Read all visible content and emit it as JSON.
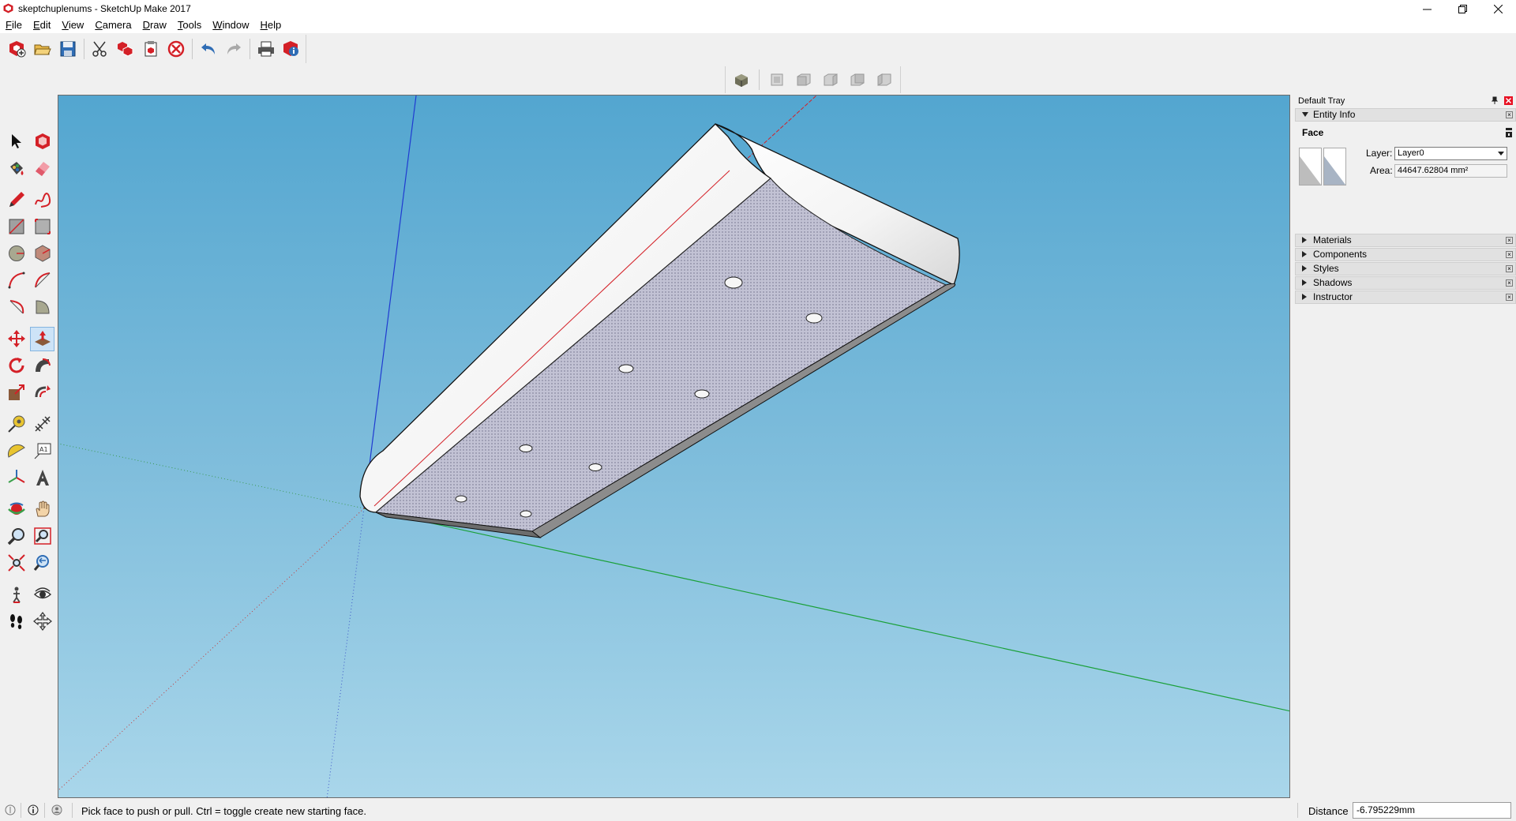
{
  "window": {
    "title": "skeptchuplenums - SketchUp Make 2017",
    "minimize_icon": "minimize-icon",
    "restore_icon": "restore-icon",
    "close_icon": "close-icon"
  },
  "menu": {
    "items": [
      "File",
      "Edit",
      "View",
      "Camera",
      "Draw",
      "Tools",
      "Window",
      "Help"
    ]
  },
  "toolbar": {
    "buttons": [
      "new-model-icon",
      "open-icon",
      "save-icon",
      "cut-icon",
      "copy-icon",
      "paste-icon",
      "erase-icon",
      "undo-icon",
      "redo-icon",
      "print-icon",
      "model-info-icon"
    ]
  },
  "views_toolbar": {
    "buttons": [
      "iso-view-icon",
      "top-view-icon",
      "front-view-icon",
      "right-view-icon",
      "back-view-icon",
      "left-view-icon"
    ]
  },
  "left_toolbar": {
    "active_tool": "push-pull-icon"
  },
  "tray": {
    "title": "Default Tray",
    "entity_info": {
      "header": "Entity Info",
      "type": "Face",
      "layer_label": "Layer:",
      "layer_value": "Layer0",
      "area_label": "Area:",
      "area_value": "44647.62804 mm²"
    },
    "panels": [
      "Materials",
      "Components",
      "Styles",
      "Shadows",
      "Instructor"
    ]
  },
  "status": {
    "message": "Pick face to push or pull.  Ctrl = toggle create new starting face.",
    "distance_label": "Distance",
    "distance_value": "-6.795229mm"
  },
  "colors": {
    "sky_top": "#53a6d0",
    "sky_bottom": "#a9d6ea",
    "face_fill": "#b9b9cf",
    "accent_red": "#d42027"
  }
}
